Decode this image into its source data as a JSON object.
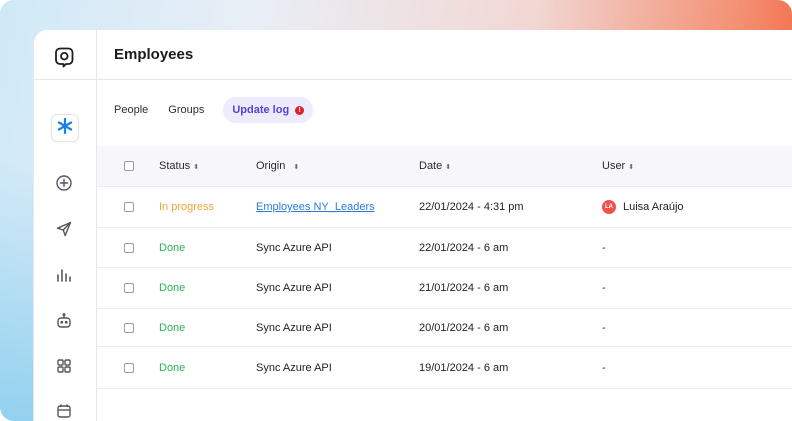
{
  "page": {
    "title": "Employees"
  },
  "tabs": [
    {
      "label": "People"
    },
    {
      "label": "Groups"
    },
    {
      "label": "Update log",
      "badge": "!"
    }
  ],
  "table": {
    "columns": [
      "Status",
      "Origin",
      "Date",
      "User"
    ],
    "rows": [
      {
        "status": "In progress",
        "origin": "Employees NY_Leaders",
        "date": "22/01/2024 - 4:31 pm",
        "user": "Luisa Araújo",
        "user_initials": "LA"
      },
      {
        "status": "Done",
        "origin": "Sync Azure API",
        "date": "22/01/2024 - 6 am",
        "user": "-"
      },
      {
        "status": "Done",
        "origin": "Sync Azure API",
        "date": "21/01/2024 - 6 am",
        "user": "-"
      },
      {
        "status": "Done",
        "origin": "Sync Azure API",
        "date": "20/01/2024 - 6 am",
        "user": "-"
      },
      {
        "status": "Done",
        "origin": "Sync Azure API",
        "date": "19/01/2024 - 6 am",
        "user": "-"
      }
    ]
  },
  "colors": {
    "accent": "#5a3fd4",
    "in_progress": "#f0a43b",
    "done": "#2bb35a",
    "link": "#2b7bd8",
    "active_nav": "#1a7fe6"
  },
  "sidebar": {
    "icons": [
      "logo-icon",
      "asterisk-icon",
      "plus-circle-icon",
      "send-icon",
      "bar-chart-icon",
      "robot-icon",
      "grid-icon",
      "calendar-icon"
    ]
  }
}
